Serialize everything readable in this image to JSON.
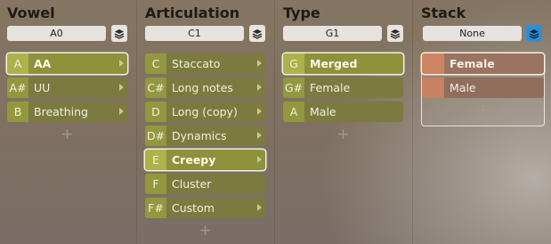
{
  "columns": {
    "vowel": {
      "title": "Vowel",
      "key": "A0",
      "items": [
        {
          "key": "A",
          "label": "AA"
        },
        {
          "key": "A#",
          "label": "UU"
        },
        {
          "key": "B",
          "label": "Breathing"
        }
      ],
      "add": "+"
    },
    "articulation": {
      "title": "Articulation",
      "key": "C1",
      "items": [
        {
          "key": "C",
          "label": "Staccato"
        },
        {
          "key": "C#",
          "label": "Long notes"
        },
        {
          "key": "D",
          "label": "Long (copy)"
        },
        {
          "key": "D#",
          "label": "Dynamics"
        },
        {
          "key": "E",
          "label": "Creepy"
        },
        {
          "key": "F",
          "label": "Cluster"
        },
        {
          "key": "F#",
          "label": "Custom"
        }
      ],
      "add": "+"
    },
    "type": {
      "title": "Type",
      "key": "G1",
      "items": [
        {
          "key": "G",
          "label": "Merged"
        },
        {
          "key": "G#",
          "label": "Female"
        },
        {
          "key": "A",
          "label": "Male"
        }
      ],
      "add": "+"
    },
    "stack": {
      "title": "Stack",
      "key": "None",
      "items": [
        {
          "key": "",
          "label": "Female"
        },
        {
          "key": "",
          "label": "Male"
        }
      ],
      "add": "+"
    }
  },
  "icons": {
    "layers": "layers-icon",
    "expand": "chevron-right-icon",
    "add": "plus-icon"
  },
  "colors": {
    "row": "#7c7a3f",
    "row_key": "#93983f",
    "stack_row": "#8f6e5c",
    "stack_key": "#c68261",
    "active_layer_button": "#2f8ed8",
    "title_text": "#1f1b16"
  }
}
